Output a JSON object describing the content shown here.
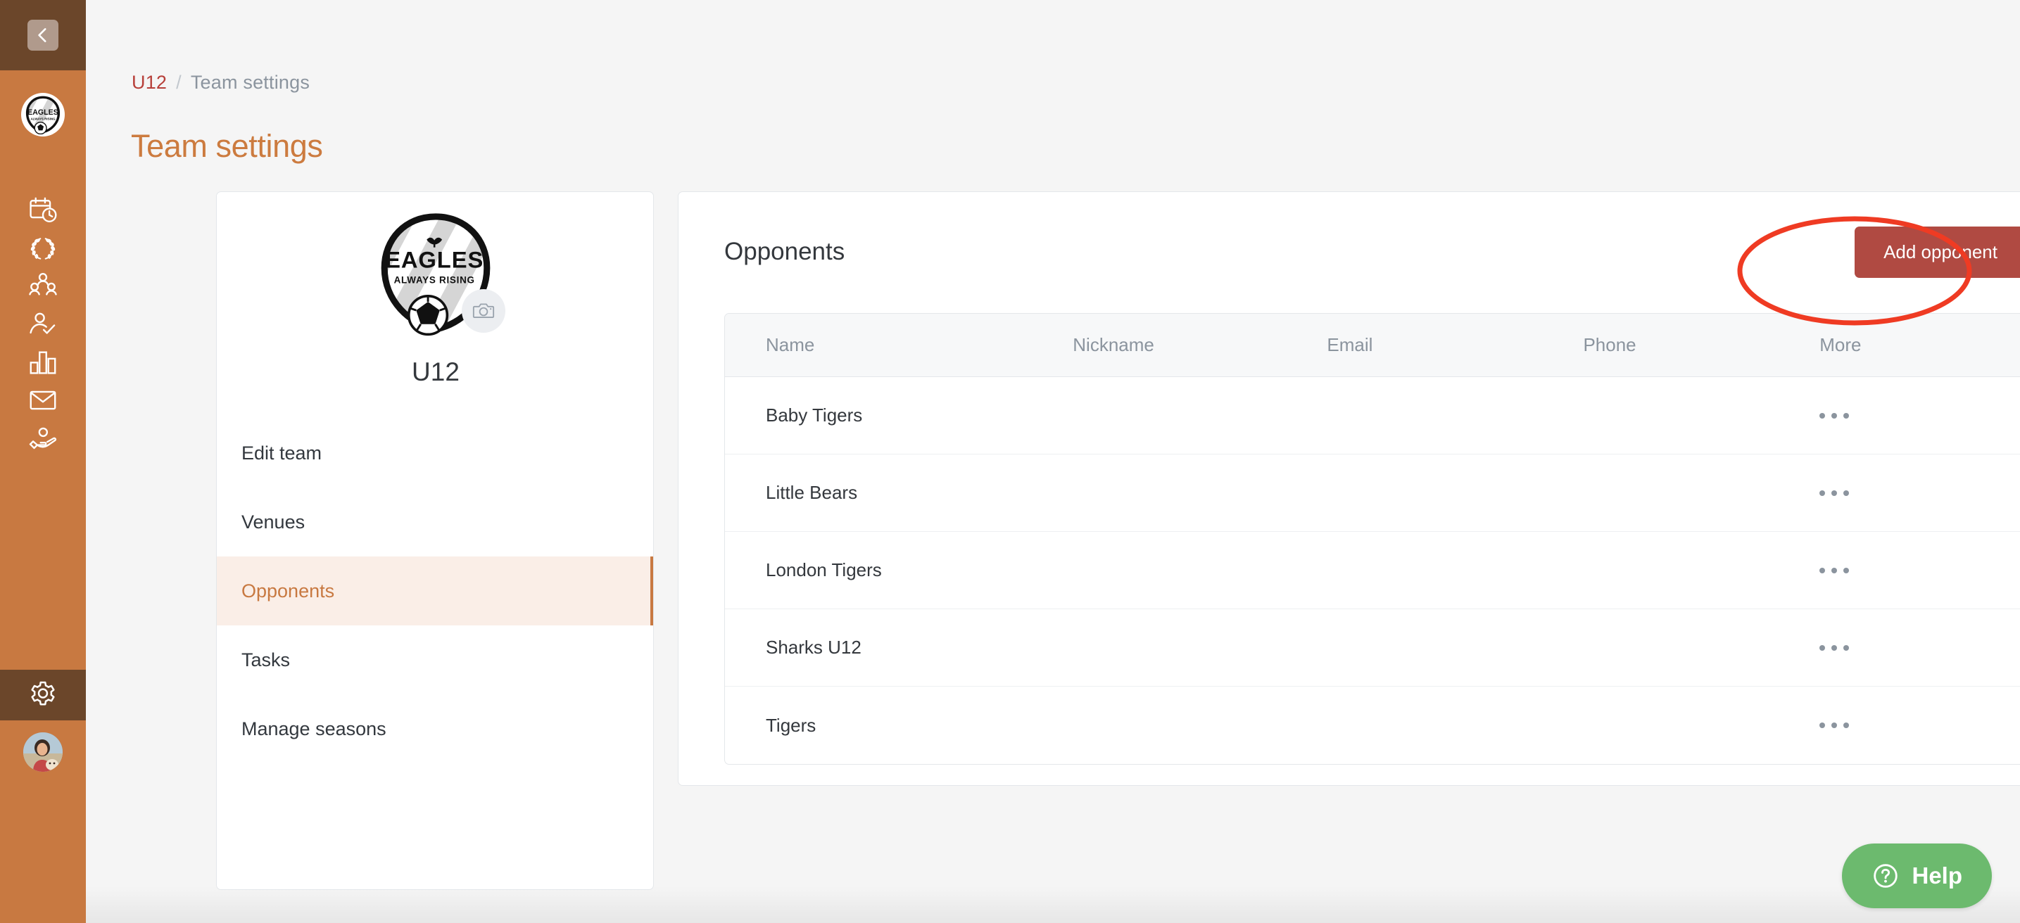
{
  "sidebar": {
    "collapse_label": "collapse-sidebar",
    "brand": {
      "name": "Eagles",
      "tagline": "ALWAYS RISING"
    },
    "items": [
      {
        "label": "Schedule",
        "icon": "calendar-clock-icon",
        "active": false
      },
      {
        "label": "Competitions",
        "icon": "laurel-wreath-icon",
        "active": false
      },
      {
        "label": "Members",
        "icon": "people-group-icon",
        "active": false
      },
      {
        "label": "Attendance",
        "icon": "person-check-icon",
        "active": false
      },
      {
        "label": "Statistics",
        "icon": "bar-chart-icon",
        "active": false
      },
      {
        "label": "Messages",
        "icon": "envelope-icon",
        "active": false
      },
      {
        "label": "Sponsors",
        "icon": "hand-coin-icon",
        "active": false
      }
    ],
    "settings": {
      "label": "Settings",
      "icon": "gear-icon",
      "active": true
    },
    "avatar": {
      "label": "User profile",
      "icon": "avatar"
    }
  },
  "breadcrumb": {
    "link": "U12",
    "separator": "/",
    "current": "Team settings"
  },
  "page": {
    "title": "Team settings"
  },
  "team_card": {
    "logo": {
      "title": "EAGLES",
      "subtitle": "ALWAYS RISING"
    },
    "camera_icon": "camera-icon",
    "name": "U12",
    "menu": [
      {
        "label": "Edit team",
        "active": false
      },
      {
        "label": "Venues",
        "active": false
      },
      {
        "label": "Opponents",
        "active": true
      },
      {
        "label": "Tasks",
        "active": false
      },
      {
        "label": "Manage seasons",
        "active": false
      }
    ]
  },
  "opponents": {
    "title": "Opponents",
    "add_button": "Add opponent",
    "columns": [
      "Name",
      "Nickname",
      "Email",
      "Phone",
      "More"
    ],
    "rows": [
      {
        "name": "Baby Tigers",
        "nickname": "",
        "email": "",
        "phone": "",
        "more": "more-options"
      },
      {
        "name": "Little Bears",
        "nickname": "",
        "email": "",
        "phone": "",
        "more": "more-options"
      },
      {
        "name": "London Tigers",
        "nickname": "",
        "email": "",
        "phone": "",
        "more": "more-options"
      },
      {
        "name": "Sharks U12",
        "nickname": "",
        "email": "",
        "phone": "",
        "more": "more-options"
      },
      {
        "name": "Tigers",
        "nickname": "",
        "email": "",
        "phone": "",
        "more": "more-options"
      }
    ]
  },
  "help": {
    "label": "Help",
    "icon": "question-circle-icon"
  },
  "annotation": {
    "shape": "ellipse",
    "color": "#ef3b23",
    "targets": "add-opponent-button"
  },
  "colors": {
    "sidebar": "#c87941",
    "sidebar_dark": "#6b462a",
    "accent": "#c87941",
    "title": "#cc7b3f",
    "breadcrumb_link": "#b7403a",
    "primary_button": "#b04a42",
    "active_menu_bg": "#faeee7",
    "help_green": "#6cba6e",
    "annotation_red": "#ef3b23"
  }
}
